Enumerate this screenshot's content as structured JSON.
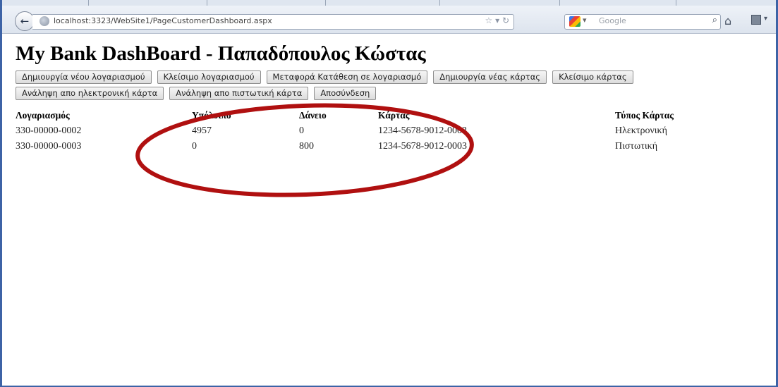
{
  "browser": {
    "url": "localhost:3323/WebSite1/PageCustomerDashboard.aspx",
    "search_placeholder": "Google"
  },
  "page": {
    "title": "My Bank DashBoard - Παπαδόπουλος Κώστας"
  },
  "actions": [
    "Δημιουργία νέου λογαριασμού",
    "Κλείσιμο λογαριασμού",
    "Μεταφορά Κατάθεση σε λογαριασμό",
    "Δημιουργία νέας κάρτας",
    "Κλείσιμο κάρτας",
    "Ανάληψη απο ηλεκτρονική κάρτα",
    "Ανάληψη απο πιστωτική κάρτα",
    "Αποσύνδεση"
  ],
  "table": {
    "headers": [
      "Λογαριασμός",
      "Υπόλοιπο",
      "Δάνειο",
      "Κάρτας",
      "Τύπος Κάρτας"
    ],
    "rows": [
      [
        "330-00000-0002",
        "4957",
        "0",
        "1234-5678-9012-0002",
        "Ηλεκτρονική"
      ],
      [
        "330-00000-0003",
        "0",
        "800",
        "1234-5678-9012-0003",
        "Πιστωτική"
      ]
    ]
  },
  "annotation": {
    "color": "#b01010"
  }
}
